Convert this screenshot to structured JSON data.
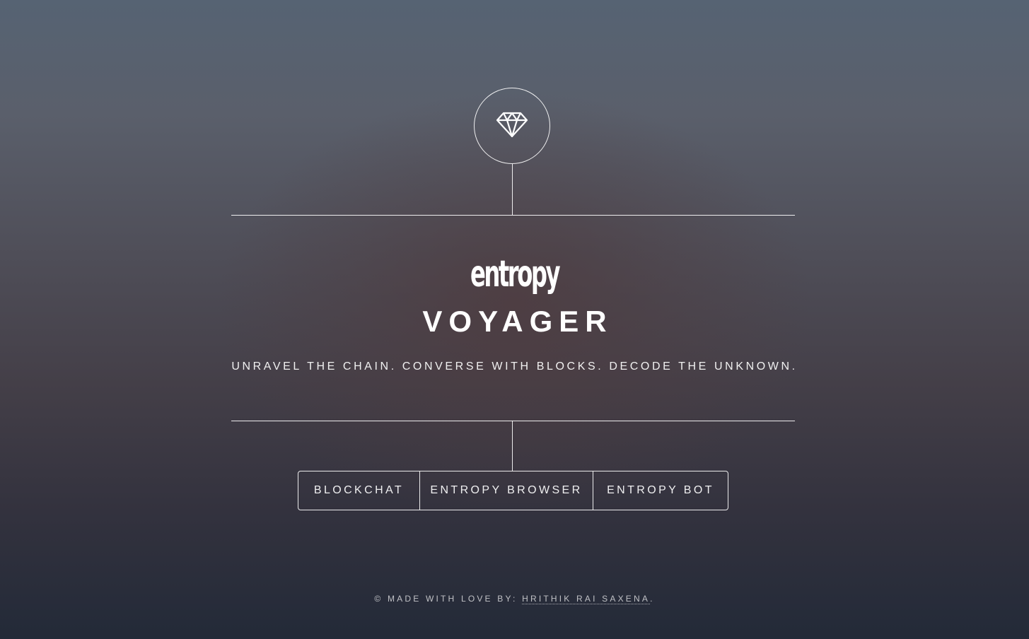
{
  "header": {
    "logo_icon": "diamond-icon"
  },
  "brand": {
    "logo_text": "entropy",
    "title": "VOYAGER",
    "tagline": "UNRAVEL THE CHAIN. CONVERSE WITH BLOCKS. DECODE THE UNKNOWN."
  },
  "nav": {
    "items": [
      {
        "label": "BLOCKCHAT"
      },
      {
        "label": "ENTROPY BROWSER"
      },
      {
        "label": "ENTROPY BOT"
      }
    ]
  },
  "footer": {
    "prefix": "© MADE WITH LOVE BY: ",
    "author": "HRITHIK RAI SAXENA",
    "suffix": "."
  },
  "colors": {
    "text": "#ffffff",
    "bg_top": "#566373",
    "bg_bottom": "#232a38",
    "glow": "#4e3c40"
  }
}
